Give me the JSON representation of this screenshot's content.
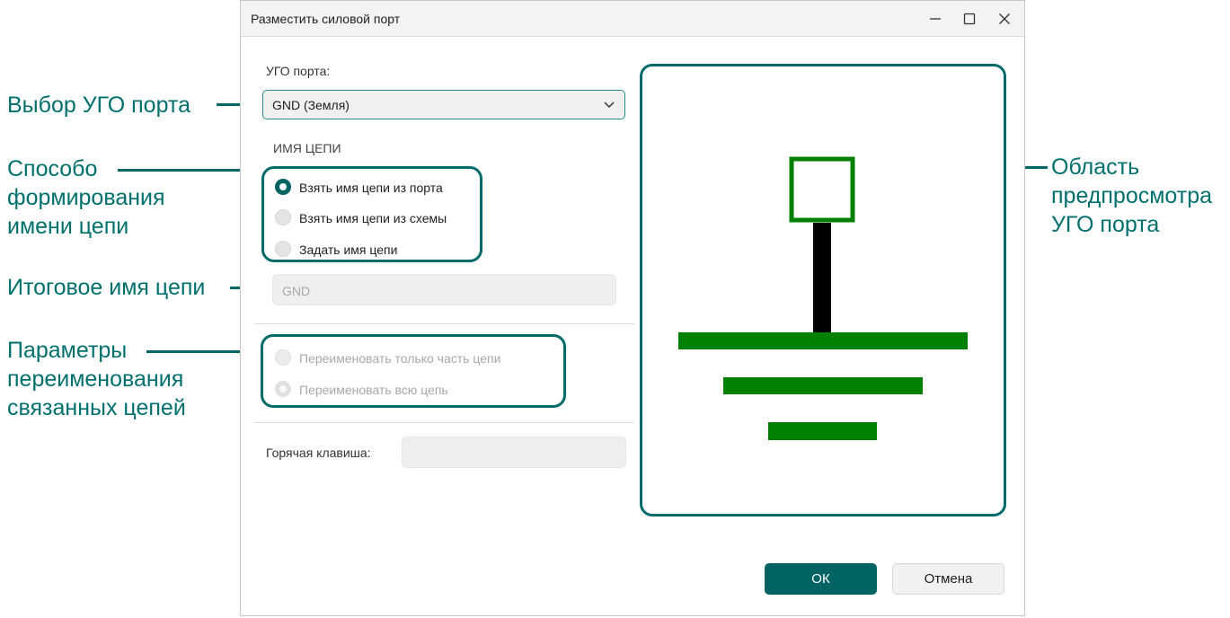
{
  "annotations": {
    "port_symbol_select": "Выбор УГО порта",
    "naming_method": [
      "Способо",
      "формирования",
      "имени цепи"
    ],
    "final_net_name": "Итоговое имя цепи",
    "rename_params": [
      "Параметры",
      "переименования",
      "связанных цепей"
    ],
    "preview_area": [
      "Область",
      "предпросмотра",
      "УГО порта"
    ]
  },
  "dialog": {
    "title": "Разместить силовой порт",
    "port_symbol": {
      "label": "УГО порта:",
      "selected": "GND (Земля)"
    },
    "net_name": {
      "section_title": "ИМЯ ЦЕПИ",
      "options": [
        {
          "label": "Взять имя цепи из порта",
          "checked": true
        },
        {
          "label": "Взять имя цепи из схемы",
          "checked": false
        },
        {
          "label": "Задать имя цепи",
          "checked": false
        }
      ],
      "value": "GND"
    },
    "rename": {
      "options": [
        {
          "label": "Переименовать только часть цепи",
          "checked": false
        },
        {
          "label": "Переименовать всю цепь",
          "checked": true
        }
      ]
    },
    "hotkey": {
      "label": "Горячая клавиша:",
      "value": ""
    },
    "buttons": {
      "ok": "ОК",
      "cancel": "Отмена"
    }
  },
  "colors": {
    "accent": "#006363",
    "annotation": "#00706e",
    "symbol_green": "#008000",
    "symbol_black": "#000000"
  }
}
